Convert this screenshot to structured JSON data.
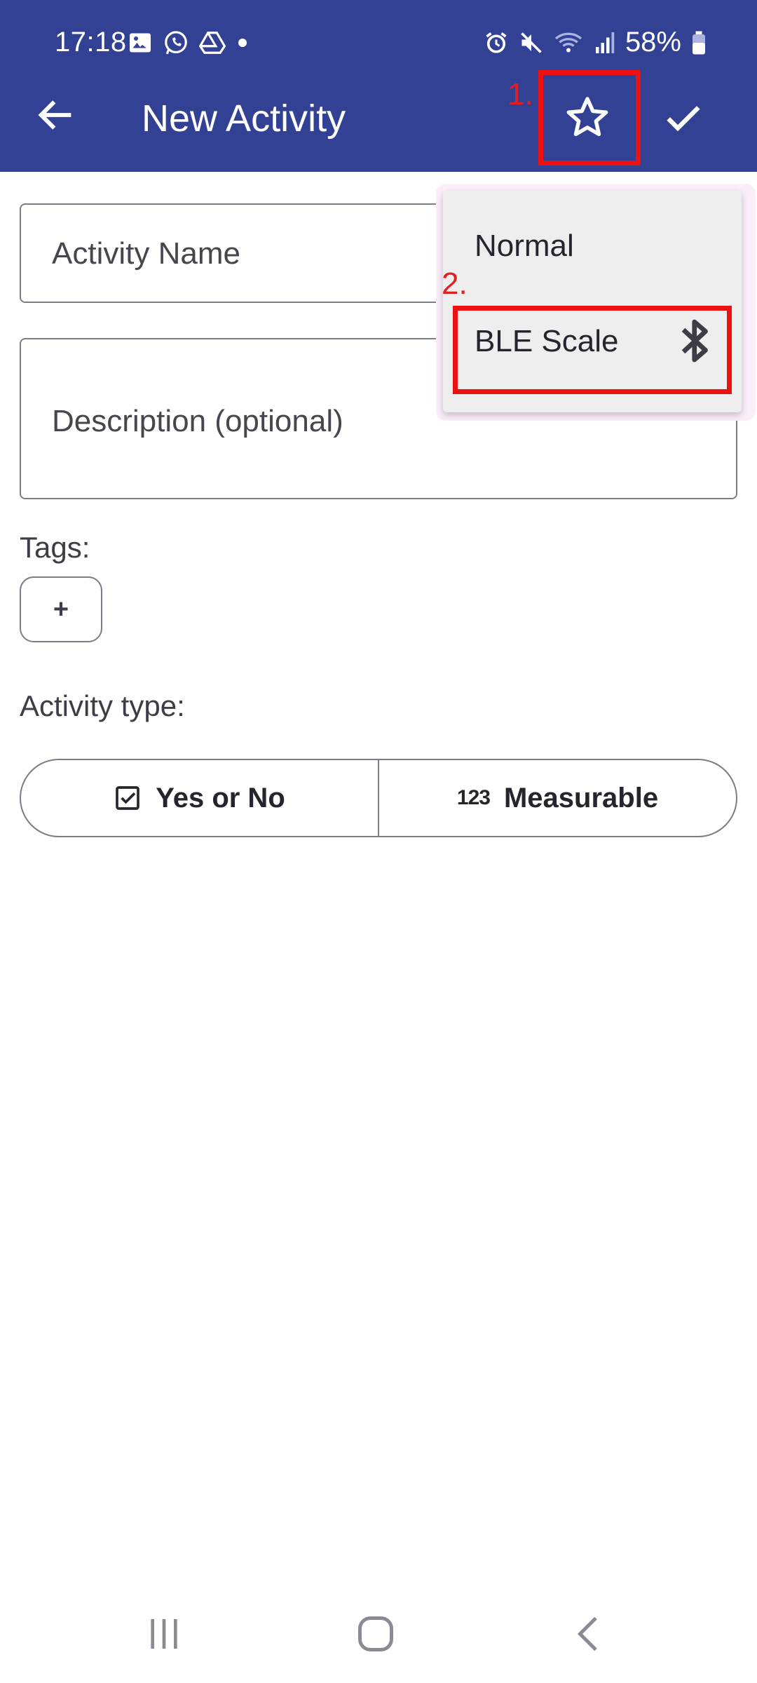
{
  "status_bar": {
    "time": "17:18",
    "battery": "58%",
    "notification_icons": [
      "gallery-icon",
      "whatsapp-icon",
      "drive-icon",
      "dot-icon"
    ],
    "system_icons": [
      "alarm-icon",
      "mute-icon",
      "wifi-icon",
      "signal-icon",
      "battery-icon"
    ]
  },
  "toolbar": {
    "title": "New Activity",
    "back_icon": "arrow-back-icon",
    "star_icon": "star-outline-icon",
    "save_icon": "check-icon"
  },
  "form": {
    "name_placeholder": "Activity Name",
    "description_placeholder": "Description (optional)",
    "tags_label": "Tags:",
    "add_tag_label": "+",
    "activity_type_label": "Activity type:",
    "types": [
      {
        "label": "Yes or No",
        "icon": "checkbox-icon"
      },
      {
        "label": "Measurable",
        "icon": "numbers-icon",
        "icon_text": "123"
      }
    ]
  },
  "menu": {
    "items": [
      {
        "label": "Normal"
      },
      {
        "label": "BLE Scale",
        "icon": "bluetooth-icon"
      }
    ]
  },
  "annotations": {
    "step1": "1.",
    "step2": "2.",
    "color": "#ee1111"
  },
  "colors": {
    "appbar": "#334194",
    "menu_bg": "#eeeeee",
    "border": "#7c7c86"
  }
}
